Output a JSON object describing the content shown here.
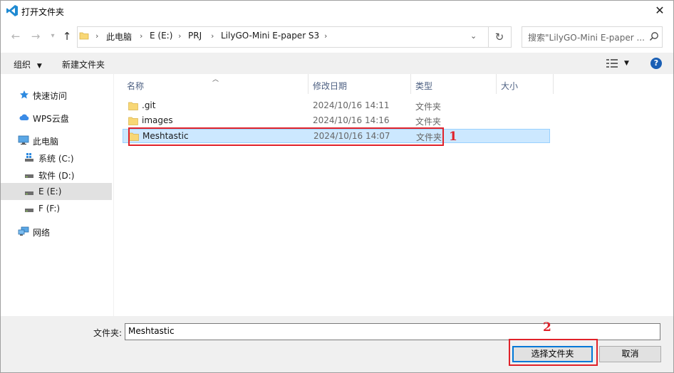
{
  "window": {
    "title": "打开文件夹"
  },
  "nav": {
    "breadcrumbs": [
      "此电脑",
      "E (E:)",
      "PRJ",
      "LilyGO-Mini E-paper S3"
    ],
    "search_placeholder": "搜索\"LilyGO-Mini E-paper ..."
  },
  "toolbar": {
    "organize": "组织",
    "new_folder": "新建文件夹"
  },
  "sidebar": {
    "items": [
      {
        "label": "快速访问",
        "icon": "star-icon"
      },
      {
        "label": "WPS云盘",
        "icon": "cloud-icon"
      },
      {
        "label": "此电脑",
        "icon": "computer-icon"
      },
      {
        "label": "系统 (C:)",
        "icon": "windows-drive-icon"
      },
      {
        "label": "软件 (D:)",
        "icon": "drive-icon"
      },
      {
        "label": "E (E:)",
        "icon": "drive-icon",
        "selected": true
      },
      {
        "label": "F (F:)",
        "icon": "drive-icon"
      },
      {
        "label": "网络",
        "icon": "network-icon"
      }
    ]
  },
  "columns": {
    "name": "名称",
    "date": "修改日期",
    "type": "类型",
    "size": "大小"
  },
  "files": [
    {
      "name": ".git",
      "date": "2024/10/16 14:11",
      "type": "文件夹"
    },
    {
      "name": "images",
      "date": "2024/10/16 14:16",
      "type": "文件夹"
    },
    {
      "name": "Meshtastic",
      "date": "2024/10/16 14:07",
      "type": "文件夹",
      "selected": true
    }
  ],
  "annotations": {
    "step1": "1",
    "step2": "2"
  },
  "footer": {
    "filename_label": "文件夹:",
    "filename_value": "Meshtastic",
    "select_button": "选择文件夹",
    "cancel_button": "取消"
  },
  "colors": {
    "accent": "#0078d7",
    "selection": "#cce8ff",
    "annotation": "#e0222a"
  }
}
